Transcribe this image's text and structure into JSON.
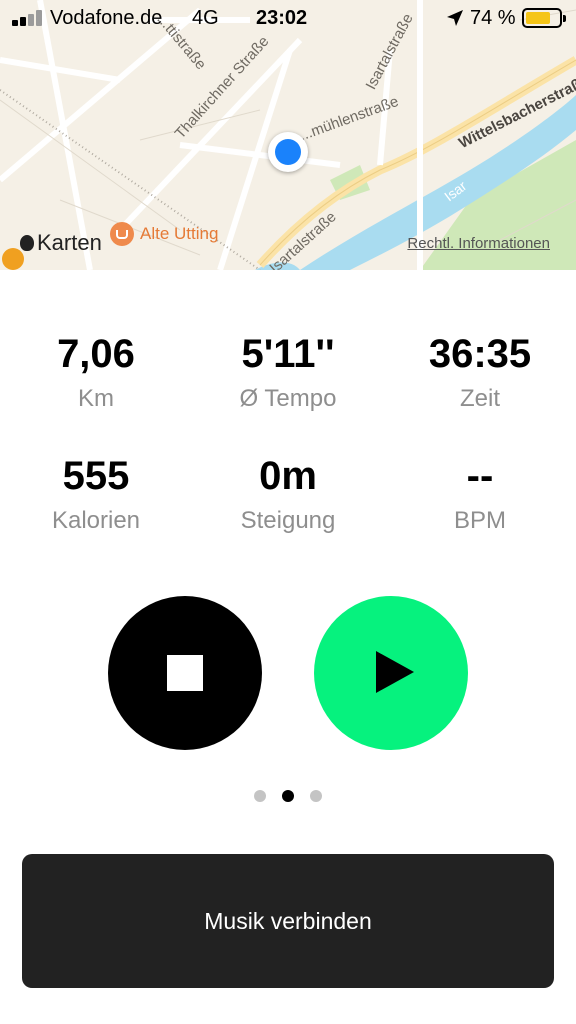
{
  "status_bar": {
    "carrier": "Vodafone.de",
    "network": "4G",
    "time": "23:02",
    "battery_percent": "74 %",
    "battery_level": 0.74,
    "signal_bars": 2,
    "icons": [
      "signal-icon",
      "location-arrow-icon",
      "battery-icon"
    ]
  },
  "map": {
    "streets": [
      "Thalkirchner Straße",
      "...mühlenstraße",
      "Isartalstraße",
      "Isartalstraße",
      "Wittelsbacherstraße",
      "Isar",
      "...ttistraße"
    ],
    "poi": {
      "label": "Alte Utting",
      "icon": "cafe-icon"
    },
    "logo_text": "Karten",
    "legal_link": "Rechtl. Informationen",
    "colors": {
      "land": "#f5f0e6",
      "water": "#a9dcf0",
      "park": "#cfe8b8",
      "road_major": "#fbe3a7",
      "user_location": "#1a82fb"
    }
  },
  "stats": [
    {
      "value": "7,06",
      "label": "Km"
    },
    {
      "value": "5'11''",
      "label": "Ø Tempo"
    },
    {
      "value": "36:35",
      "label": "Zeit"
    },
    {
      "value": "555",
      "label": "Kalorien"
    },
    {
      "value": "0m",
      "label": "Steigung"
    },
    {
      "value": "--",
      "label": "BPM"
    }
  ],
  "controls": {
    "stop_icon": "stop-icon",
    "play_icon": "play-icon",
    "colors": {
      "stop": "#000000",
      "play": "#06f27e"
    }
  },
  "pager": {
    "count": 3,
    "active_index": 1
  },
  "music_button": {
    "label": "Musik verbinden"
  }
}
